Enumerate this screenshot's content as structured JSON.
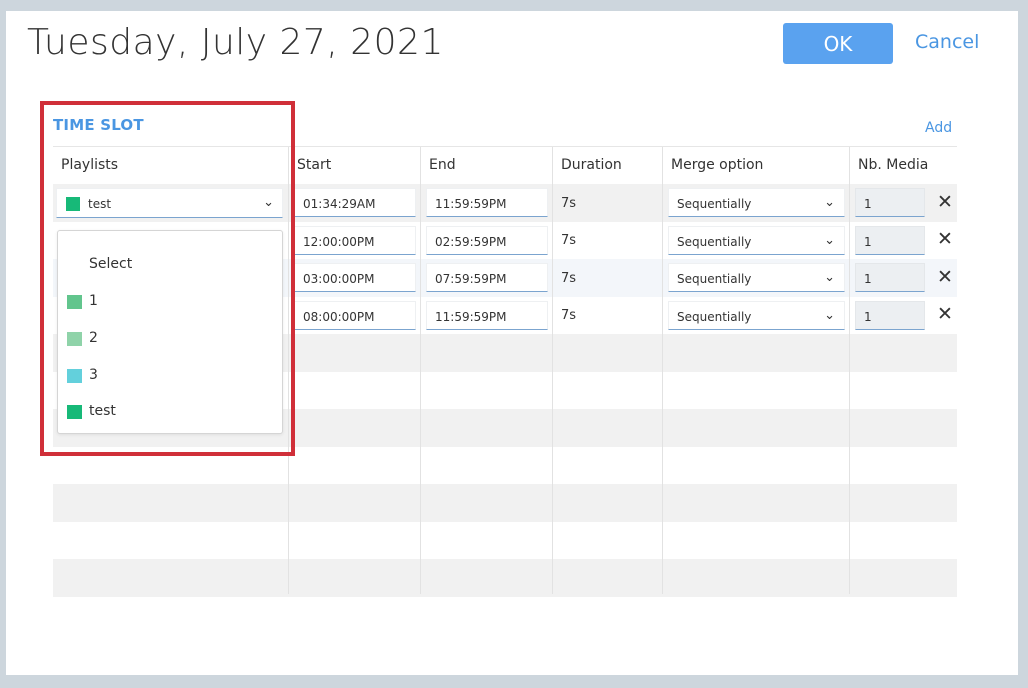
{
  "dialog": {
    "title": "Tuesday, July 27, 2021",
    "ok_label": "OK",
    "cancel_label": "Cancel"
  },
  "section": {
    "title": "TIME SLOT",
    "add_label": "Add"
  },
  "columns": {
    "playlists": "Playlists",
    "start": "Start",
    "end": "End",
    "duration": "Duration",
    "merge": "Merge option",
    "nb_media": "Nb. Media"
  },
  "rows": [
    {
      "playlist": "test",
      "start": "01:34:29AM",
      "end": "11:59:59PM",
      "duration": "7s",
      "merge": "Sequentially",
      "nb_media": "1"
    },
    {
      "playlist": "",
      "start": "12:00:00PM",
      "end": "02:59:59PM",
      "duration": "7s",
      "merge": "Sequentially",
      "nb_media": "1"
    },
    {
      "playlist": "",
      "start": "03:00:00PM",
      "end": "07:59:59PM",
      "duration": "7s",
      "merge": "Sequentially",
      "nb_media": "1"
    },
    {
      "playlist": "",
      "start": "08:00:00PM",
      "end": "11:59:59PM",
      "duration": "7s",
      "merge": "Sequentially",
      "nb_media": "1"
    }
  ],
  "playlist_select": {
    "value": "test",
    "color": "#17b978",
    "options": [
      {
        "label": "Select",
        "color": ""
      },
      {
        "label": "1",
        "color": "#62c58d"
      },
      {
        "label": "2",
        "color": "#8fd3a9"
      },
      {
        "label": "3",
        "color": "#63d0dc"
      },
      {
        "label": "test",
        "color": "#17b978"
      }
    ]
  },
  "icons": {
    "chevron": "chevron-down-icon",
    "delete": "close-icon"
  },
  "colors": {
    "accent": "#5aa2ef",
    "link": "#4a96e2",
    "highlight": "#d02f39"
  }
}
